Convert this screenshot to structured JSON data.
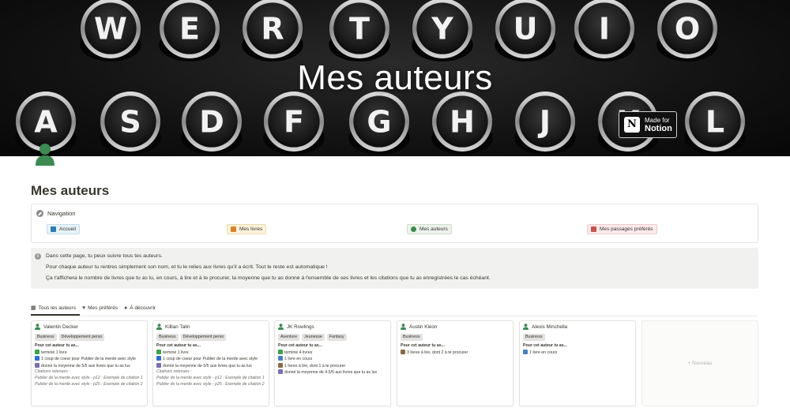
{
  "cover": {
    "title": "Mes auteurs",
    "keys_top": [
      "W",
      "E",
      "R",
      "T",
      "Y",
      "U",
      "I",
      "O"
    ],
    "keys_bottom": [
      "A",
      "S",
      "D",
      "F",
      "G",
      "H",
      "J",
      "K",
      "L"
    ],
    "badge": {
      "line1": "Made for",
      "line2": "Notion",
      "logo": "N"
    }
  },
  "page": {
    "title": "Mes auteurs",
    "icon": "person-icon"
  },
  "navigation": {
    "heading": "Navigation",
    "links": [
      {
        "label": "Accueil",
        "icon": "home-icon",
        "color": "#e7f3f8"
      },
      {
        "label": "Mes livres",
        "icon": "books-icon",
        "color": "#fbf3db"
      },
      {
        "label": "Mes auteurs",
        "icon": "person-icon",
        "color": "#edf3ec"
      },
      {
        "label": "Mes passages préférés",
        "icon": "bookmark-icon",
        "color": "#fdebec"
      }
    ]
  },
  "info": {
    "icon": "info-icon",
    "lines": [
      "Dans cette page, tu peux suivre tous tes auteurs.",
      "Pour chaque auteur tu rentres simplement son nom, et tu le relies aux livres qu'il a écrit. Tout le reste est automatique !",
      "Ça t'affichera le nombre de livres que tu as lu, en cours, à lire et à te procurer, la moyenne que tu as donné à l'ensemble de ses livres et les citations que tu as enregistrées le cas échéant."
    ]
  },
  "tabs": [
    {
      "label": "Tous les auteurs",
      "icon": "gallery-icon",
      "active": true
    },
    {
      "label": "Mes préférés",
      "icon": "heart-icon",
      "active": false
    },
    {
      "label": "À découvrir",
      "icon": "person-icon",
      "active": false
    }
  ],
  "cards": [
    {
      "name": "Valentin Decker",
      "tags": [
        "Business",
        "Développement perso"
      ],
      "heading": "Pour cet auteur tu as...",
      "lines": [
        {
          "icon": "check-icon",
          "text": "terminé 1 livre"
        },
        {
          "icon": "blue-heart-icon",
          "text": "1 coup de coeur pour Publier de la merde avec style"
        },
        {
          "icon": "chart-icon",
          "text": "donné la moyenne de 5/5 aux livres que tu as lus"
        }
      ],
      "quotes_label": "Citations retenues :",
      "quotes": [
        "Publier de la merde avec style - p12 : Exemple de citation 1",
        "Publier de la merde avec style - p25 : Exemple de citation 2"
      ]
    },
    {
      "name": "Killian Talin",
      "tags": [
        "Business",
        "Développement perso"
      ],
      "heading": "Pour cet auteur tu as...",
      "lines": [
        {
          "icon": "check-icon",
          "text": "terminé 1 livre"
        },
        {
          "icon": "blue-heart-icon",
          "text": "1 coup de coeur pour Publier de la merde avec style"
        },
        {
          "icon": "chart-icon",
          "text": "donné la moyenne de 5/5 aux livres que tu as lus"
        }
      ],
      "quotes_label": "Citations retenues :",
      "quotes": [
        "Publier de la merde avec style - p12 : Exemple de citation 1",
        "Publier de la merde avec style - p25 : Exemple de citation 2"
      ]
    },
    {
      "name": "JK Rowlings",
      "tags": [
        "Aventure",
        "Jeunesse",
        "Fantasy"
      ],
      "heading": "Pour cet auteur tu as...",
      "lines": [
        {
          "icon": "check-icon",
          "text": "terminé 4 livres"
        },
        {
          "icon": "book-icon",
          "text": "1 livre en cours"
        },
        {
          "icon": "books-stack-icon",
          "text": "1 livres à lire, dont 1 à te procurer"
        },
        {
          "icon": "chart-icon",
          "text": "donné la moyenne de 4.5/5 aux livres que tu as lus"
        }
      ],
      "quotes_label": "",
      "quotes": []
    },
    {
      "name": "Austin Kleon",
      "tags": [
        "Business"
      ],
      "heading": "Pour cet auteur tu as...",
      "lines": [
        {
          "icon": "books-stack-icon",
          "text": "3 livres à lire, dont 2 à te procurer"
        }
      ],
      "quotes_label": "",
      "quotes": []
    },
    {
      "name": "Alexis Minchella",
      "tags": [
        "Business"
      ],
      "heading": "Pour cet auteur tu as...",
      "lines": [
        {
          "icon": "book-icon",
          "text": "1 livre en cours"
        }
      ],
      "quotes_label": "",
      "quotes": []
    }
  ],
  "new_card": {
    "label": "+ Nouveau"
  }
}
